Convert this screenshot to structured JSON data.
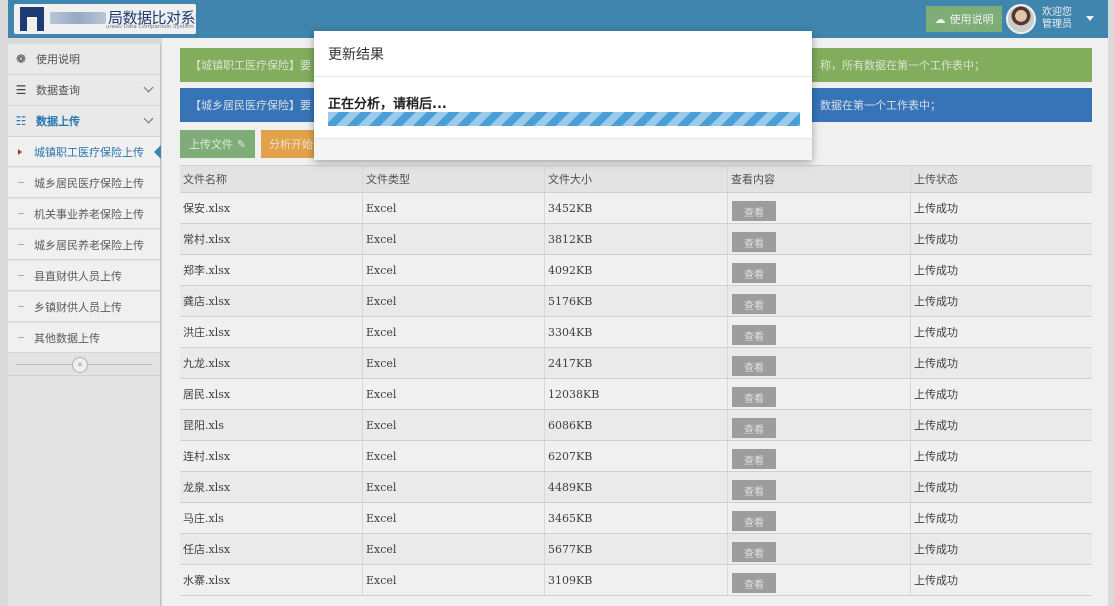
{
  "header": {
    "title": "局数据比对系统",
    "subtitle": "ureau Data Comparison System",
    "help_label": "使用说明",
    "welcome_line1": "欢迎您",
    "welcome_line2": "管理员"
  },
  "sidebar": {
    "items": [
      {
        "label": "使用说明",
        "icon": "dashboard-icon"
      },
      {
        "label": "数据查询",
        "icon": "list-icon"
      },
      {
        "label": "数据上传",
        "icon": "list-alt-icon"
      }
    ],
    "sub_items": [
      {
        "label": "城镇职工医疗保险上传",
        "active": true
      },
      {
        "label": "城乡居民医疗保险上传",
        "active": false
      },
      {
        "label": "机关事业养老保险上传",
        "active": false
      },
      {
        "label": "城乡居民养老保险上传",
        "active": false
      },
      {
        "label": "县直财供人员上传",
        "active": false
      },
      {
        "label": "乡镇财供人员上传",
        "active": false
      },
      {
        "label": "其他数据上传",
        "active": false
      }
    ],
    "collapse_glyph": "«"
  },
  "alerts": {
    "green_left": "【城镇职工医疗保险】要",
    "green_right": "称，所有数据在第一个工作表中；",
    "blue_left": "【城乡居民医疗保险】要",
    "blue_right": "数据在第一个工作表中；"
  },
  "buttons": {
    "upload": "上传文件",
    "analyze": "分析开始"
  },
  "table": {
    "headers": [
      "文件名称",
      "文件类型",
      "文件大小",
      "查看内容",
      "上传状态"
    ],
    "view_label": "查看",
    "rows": [
      {
        "name": "保安.xlsx",
        "type": "Excel",
        "size": "3452KB",
        "status": "上传成功"
      },
      {
        "name": "常村.xlsx",
        "type": "Excel",
        "size": "3812KB",
        "status": "上传成功"
      },
      {
        "name": "郑李.xlsx",
        "type": "Excel",
        "size": "4092KB",
        "status": "上传成功"
      },
      {
        "name": "龚店.xlsx",
        "type": "Excel",
        "size": "5176KB",
        "status": "上传成功"
      },
      {
        "name": "洪庄.xlsx",
        "type": "Excel",
        "size": "3304KB",
        "status": "上传成功"
      },
      {
        "name": "九龙.xlsx",
        "type": "Excel",
        "size": "2417KB",
        "status": "上传成功"
      },
      {
        "name": "居民.xlsx",
        "type": "Excel",
        "size": "12038KB",
        "status": "上传成功"
      },
      {
        "name": "昆阳.xls",
        "type": "Excel",
        "size": "6086KB",
        "status": "上传成功"
      },
      {
        "name": "连村.xlsx",
        "type": "Excel",
        "size": "6207KB",
        "status": "上传成功"
      },
      {
        "name": "龙泉.xlsx",
        "type": "Excel",
        "size": "4489KB",
        "status": "上传成功"
      },
      {
        "name": "马庄.xls",
        "type": "Excel",
        "size": "3465KB",
        "status": "上传成功"
      },
      {
        "name": "任店.xlsx",
        "type": "Excel",
        "size": "5677KB",
        "status": "上传成功"
      },
      {
        "name": "水寨.xlsx",
        "type": "Excel",
        "size": "3109KB",
        "status": "上传成功"
      }
    ]
  },
  "modal": {
    "title": "更新结果",
    "message": "正在分析，请稍后...",
    "progress": 1.0
  },
  "colors": {
    "header_bg": "#438eb9",
    "green": "#8ab863",
    "blue": "#3a7cc3",
    "orange": "#f0ad4e",
    "progress": "#4a9fd9"
  }
}
